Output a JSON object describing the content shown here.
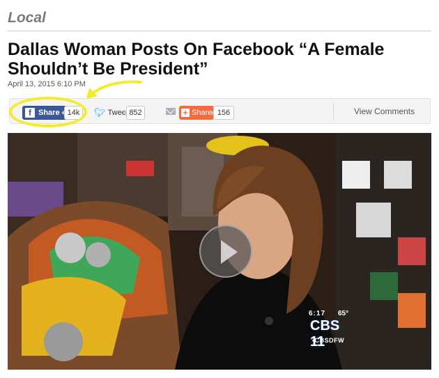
{
  "section": {
    "label": "Local"
  },
  "article": {
    "headline": "Dallas Woman Posts On Facebook “A Female Shouldn’t Be President”",
    "timestamp": "April 13, 2015 6:10 PM"
  },
  "share_bar": {
    "facebook": {
      "icon_glyph": "f",
      "label": "Share",
      "count": "14k",
      "icon": "facebook-icon"
    },
    "twitter": {
      "label": "Tweet",
      "count": "852",
      "icon": "twitter-bird-icon"
    },
    "email": {
      "icon": "email-icon"
    },
    "plus": {
      "icon_glyph": "+",
      "label": "Share",
      "count": "156"
    },
    "view_comments": "View Comments"
  },
  "annotation": {
    "color": "#f2ec2a"
  },
  "video": {
    "station_time": "6:17",
    "station_temp": "65°",
    "station_logo": "CBS 11",
    "station_name": "•CBSDFW",
    "controls": {
      "play_icon": "play-icon"
    }
  },
  "colors": {
    "facebook": "#3b5998",
    "twitter": "#1da1f2",
    "plus_share": "#f26c3d",
    "section_label": "#7a7a7a"
  }
}
